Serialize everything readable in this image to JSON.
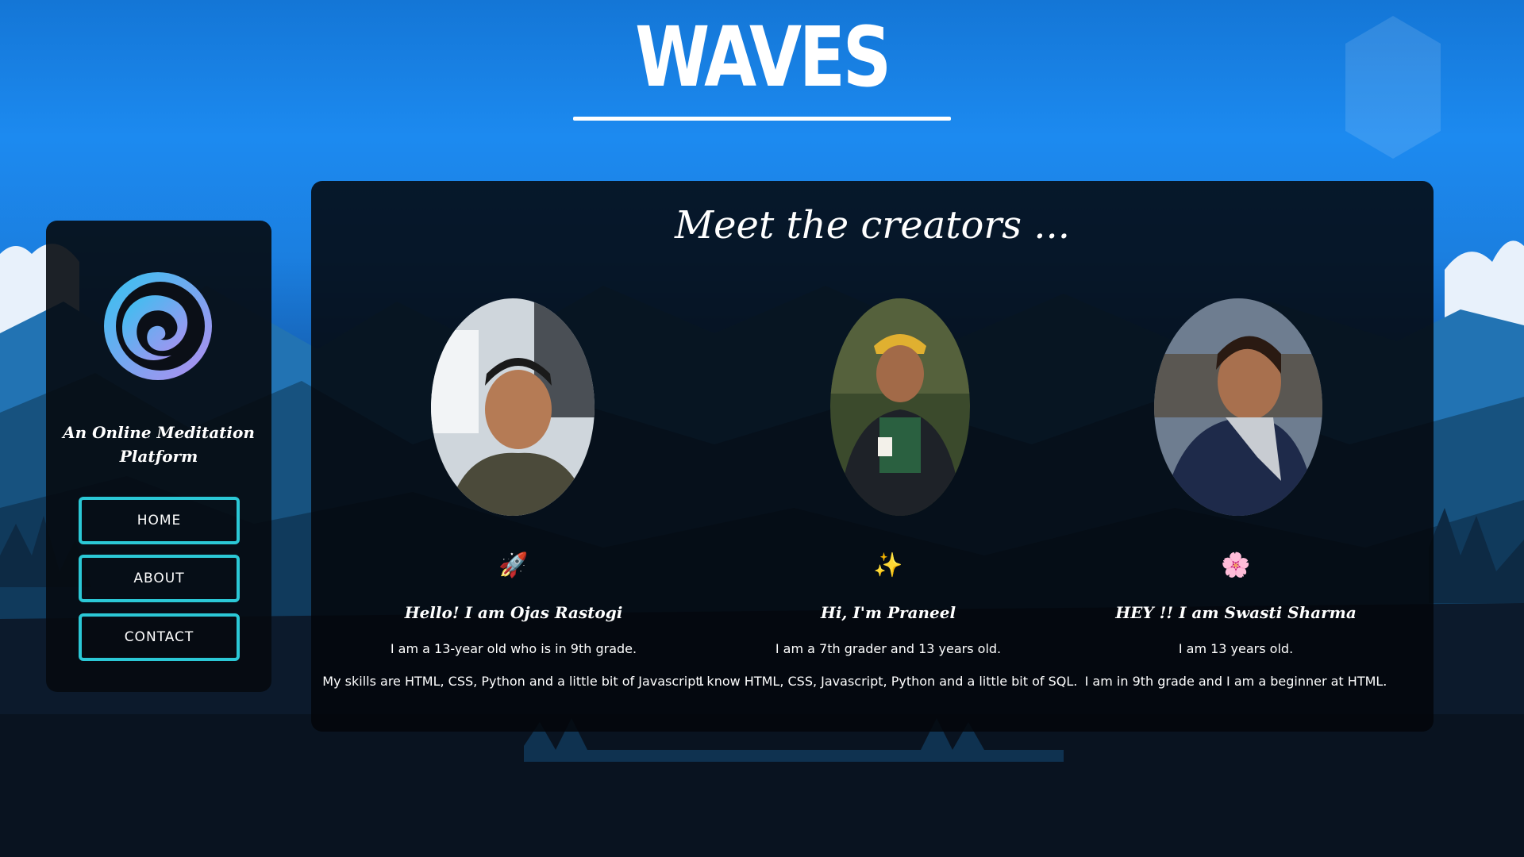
{
  "header": {
    "title": "WAVES"
  },
  "sidebar": {
    "tagline": "An Online Meditation Platform",
    "nav": [
      {
        "label": "HOME"
      },
      {
        "label": "ABOUT"
      },
      {
        "label": "CONTACT"
      }
    ]
  },
  "creators_section": {
    "heading": "Meet the creators ...",
    "creators": [
      {
        "emoji": "🚀",
        "name": "Hello! I am Ojas Rastogi",
        "line1": "I am a 13-year old who is in 9th grade.",
        "line2": "My skills are HTML, CSS, Python and a little bit of Javascript."
      },
      {
        "emoji": "✨",
        "name": "Hi, I'm Praneel",
        "line1": "I am a 7th grader and 13 years old.",
        "line2": "I know HTML, CSS, Javascript, Python and a little bit of SQL."
      },
      {
        "emoji": "🌸",
        "name": "HEY !! I am Swasti Sharma",
        "line1": "I am 13 years old.",
        "line2": "I am in 9th grade and I am a beginner at HTML."
      }
    ]
  },
  "colors": {
    "accent_border": "#2bc8d6",
    "panel_bg": "#04060a",
    "sky_blue": "#1c8af0"
  },
  "icons": {
    "logo": "swirl-wave-logo"
  }
}
